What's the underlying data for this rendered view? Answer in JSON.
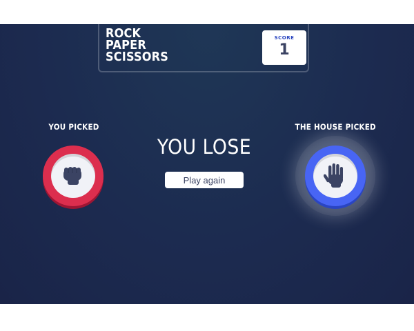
{
  "game": {
    "title_lines": [
      "ROCK",
      "PAPER",
      "SCISSORS"
    ],
    "score_label": "SCORE",
    "score_value": "1"
  },
  "result": {
    "you_picked_label": "YOU PICKED",
    "house_picked_label": "THE HOUSE PICKED",
    "player_choice": "rock",
    "house_choice": "paper",
    "message": "YOU LOSE",
    "play_again_label": "Play again"
  },
  "icons": {
    "player_icon": "rock-fist-icon",
    "house_icon": "paper-hand-icon"
  },
  "colors": {
    "background": "#1c2b50",
    "rock_ring": "#dc2e4e",
    "paper_ring": "#4865f4",
    "score_accent": "#2a46c0",
    "text_dark": "#3b4363"
  }
}
